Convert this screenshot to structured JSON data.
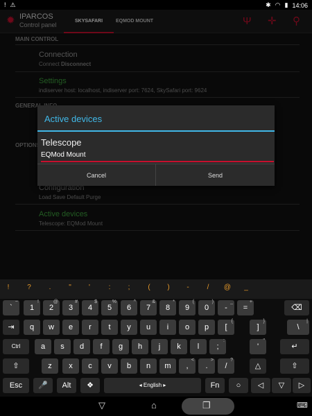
{
  "status": {
    "left_icons": [
      "warning-icon",
      "warning-icon"
    ],
    "time": "14:06"
  },
  "appbar": {
    "title": "IPARCOS",
    "subtitle": "Control panel",
    "tabs": [
      {
        "label": "SKYSAFARI",
        "active": true
      },
      {
        "label": "EQMOD MOUNT",
        "active": false
      }
    ],
    "icons": [
      "telescope-icon",
      "crosshair-icon",
      "search-icon"
    ]
  },
  "content": {
    "sections": [
      {
        "label": "MAIN CONTROL"
      },
      {
        "label": "GENERAL INFO"
      },
      {
        "label": "OPTIONS"
      }
    ],
    "items": [
      {
        "title": "Connection",
        "sub_normal": "Connect",
        "sub_bold": "Disconnect"
      },
      {
        "title": "Settings",
        "sub": "indiserver host: localhost, indiserver port: 7624, SkySafari port: 9624"
      },
      {
        "title": "Configuration",
        "sub": "Load Save Default Purge"
      },
      {
        "title": "Active devices",
        "sub": "Telescope: EQMod Mount"
      }
    ]
  },
  "dialog": {
    "title": "Active devices",
    "label": "Telescope",
    "selected": "EQMod Mount",
    "cancel": "Cancel",
    "send": "Send"
  },
  "symbols": [
    "!",
    "?",
    ".",
    "\"",
    "'",
    ":",
    ";",
    "(",
    ")",
    "-",
    "/",
    "@",
    "_"
  ],
  "keyboard": {
    "rows": [
      [
        {
          "k": "`",
          "s": "~"
        },
        {
          "k": "1",
          "s": "!"
        },
        {
          "k": "2",
          "s": "@"
        },
        {
          "k": "3",
          "s": "#"
        },
        {
          "k": "4",
          "s": "$"
        },
        {
          "k": "5",
          "s": "%"
        },
        {
          "k": "6",
          "s": "^"
        },
        {
          "k": "7",
          "s": "&"
        },
        {
          "k": "8",
          "s": "*"
        },
        {
          "k": "9",
          "s": "("
        },
        {
          "k": "0",
          "s": ")"
        },
        {
          "k": "-",
          "s": "_"
        },
        {
          "k": "=",
          "s": "+"
        },
        {
          "k": "⌫",
          "s": ""
        }
      ],
      [
        {
          "k": "⇥",
          "s": ""
        },
        {
          "k": "q",
          "s": ""
        },
        {
          "k": "w",
          "s": ""
        },
        {
          "k": "e",
          "s": ""
        },
        {
          "k": "r",
          "s": ""
        },
        {
          "k": "t",
          "s": ""
        },
        {
          "k": "y",
          "s": ""
        },
        {
          "k": "u",
          "s": ""
        },
        {
          "k": "i",
          "s": ""
        },
        {
          "k": "o",
          "s": ""
        },
        {
          "k": "p",
          "s": ""
        },
        {
          "k": "[",
          "s": "{"
        },
        {
          "k": "]",
          "s": "}"
        },
        {
          "k": "\\",
          "s": "|"
        }
      ],
      [
        {
          "k": "Ctrl",
          "s": ""
        },
        {
          "k": "a",
          "s": ""
        },
        {
          "k": "s",
          "s": ""
        },
        {
          "k": "d",
          "s": ""
        },
        {
          "k": "f",
          "s": ""
        },
        {
          "k": "g",
          "s": ""
        },
        {
          "k": "h",
          "s": ""
        },
        {
          "k": "j",
          "s": ""
        },
        {
          "k": "k",
          "s": ""
        },
        {
          "k": "l",
          "s": ""
        },
        {
          "k": ";",
          "s": ":"
        },
        {
          "k": "'",
          "s": "\""
        },
        {
          "k": "↵",
          "s": ""
        }
      ],
      [
        {
          "k": "⇧",
          "s": ""
        },
        {
          "k": "z",
          "s": ""
        },
        {
          "k": "x",
          "s": ""
        },
        {
          "k": "c",
          "s": ""
        },
        {
          "k": "v",
          "s": ""
        },
        {
          "k": "b",
          "s": ""
        },
        {
          "k": "n",
          "s": ""
        },
        {
          "k": "m",
          "s": ""
        },
        {
          "k": ",",
          "s": "<"
        },
        {
          "k": ".",
          "s": ">"
        },
        {
          "k": "/",
          "s": "?"
        },
        {
          "k": "△",
          "s": ""
        },
        {
          "k": "⇧",
          "s": ""
        }
      ],
      [
        {
          "k": "Esc",
          "s": ""
        },
        {
          "k": "🎤",
          "s": ""
        },
        {
          "k": "Alt",
          "s": ""
        },
        {
          "k": "❖",
          "s": ""
        },
        {
          "k": "◂ English ▸",
          "s": ""
        },
        {
          "k": "Fn",
          "s": ""
        },
        {
          "k": "○",
          "s": ""
        },
        {
          "k": "◁",
          "s": ""
        },
        {
          "k": "▽",
          "s": ""
        },
        {
          "k": "▷",
          "s": ""
        }
      ]
    ]
  },
  "nav": [
    "back-icon",
    "home-icon",
    "recents-icon",
    "keyboard-icon"
  ]
}
